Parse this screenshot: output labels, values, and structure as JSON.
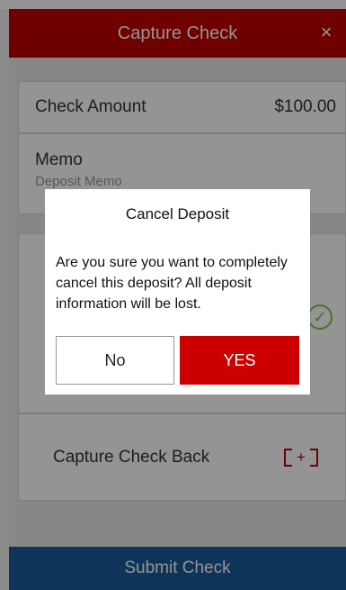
{
  "header": {
    "title": "Capture Check",
    "close_icon": "close-icon",
    "close_glyph": "×",
    "color": "#c00000"
  },
  "form": {
    "amount_label": "Check Amount",
    "amount_value": "$100.00",
    "memo_label": "Memo",
    "memo_placeholder": "Deposit Memo",
    "capture_back_label": "Capture Check Back",
    "capture_back_icon": "camera-frame-icon",
    "capture_back_glyph": "+",
    "front_status_icon": "check-circle-icon",
    "front_status_glyph": "✓"
  },
  "footer": {
    "submit_label": "Submit Check",
    "color": "#1a5a99"
  },
  "dialog": {
    "title": "Cancel Deposit",
    "message": "Are you sure you want to completely cancel this deposit? All deposit information will be lost.",
    "no_label": "No",
    "yes_label": "YES",
    "yes_color": "#cc0000"
  }
}
